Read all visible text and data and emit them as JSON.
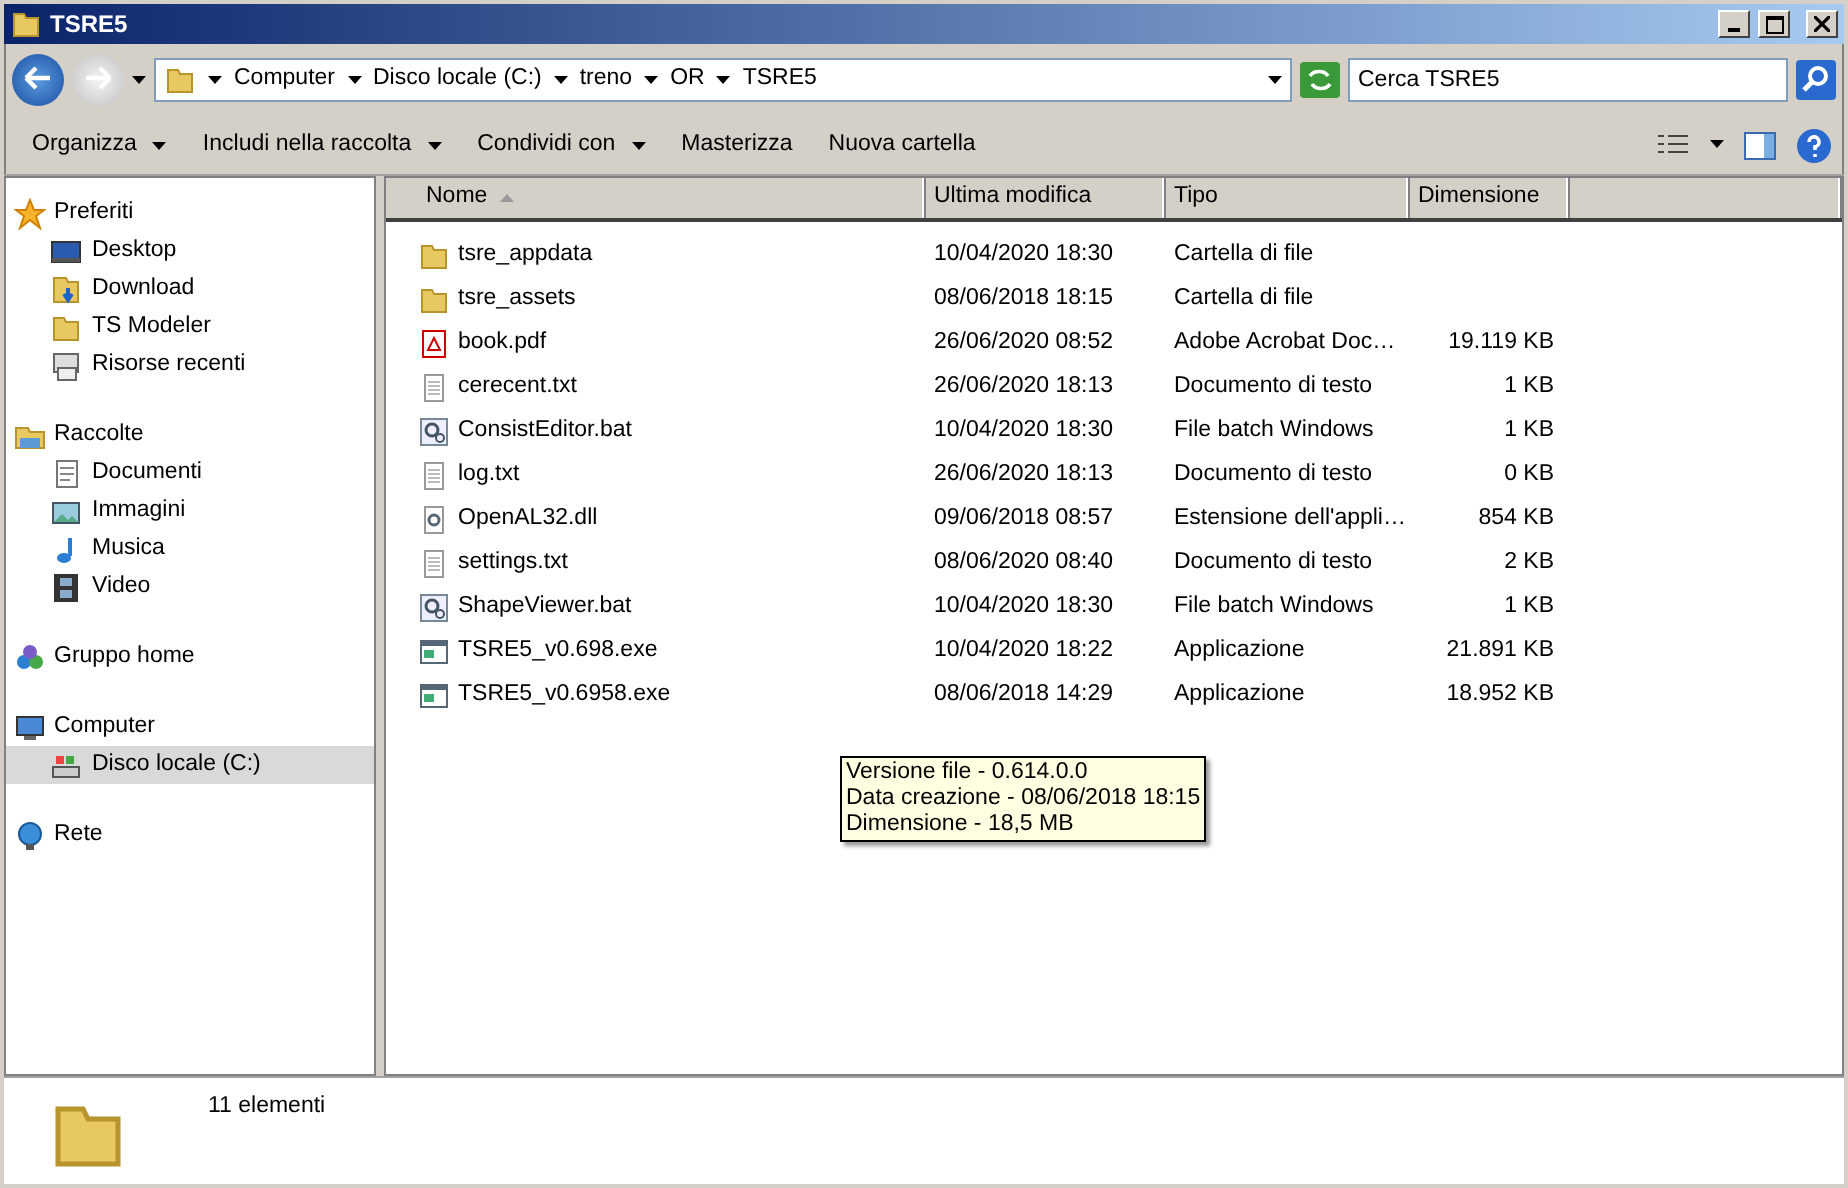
{
  "window": {
    "title": "TSRE5"
  },
  "address": {
    "breadcrumbs": [
      "Computer",
      "Disco locale (C:)",
      "treno",
      "OR",
      "TSRE5"
    ]
  },
  "search": {
    "placeholder": "Cerca TSRE5"
  },
  "toolbar": {
    "buttons": [
      {
        "label": "Organizza",
        "dropdown": true
      },
      {
        "label": "Includi nella raccolta",
        "dropdown": true
      },
      {
        "label": "Condividi con",
        "dropdown": true
      },
      {
        "label": "Masterizza",
        "dropdown": false
      },
      {
        "label": "Nuova cartella",
        "dropdown": false
      }
    ]
  },
  "sidebar": {
    "groups": [
      {
        "label": "Preferiti",
        "kind": "star",
        "selected": false,
        "items": [
          {
            "label": "Desktop",
            "kind": "desktop",
            "selected": false
          },
          {
            "label": "Download",
            "kind": "download",
            "selected": false
          },
          {
            "label": "TS Modeler",
            "kind": "folder",
            "selected": false
          },
          {
            "label": "Risorse recenti",
            "kind": "recent",
            "selected": false
          }
        ]
      },
      {
        "label": "Raccolte",
        "kind": "library",
        "selected": false,
        "items": [
          {
            "label": "Documenti",
            "kind": "document",
            "selected": false
          },
          {
            "label": "Immagini",
            "kind": "image",
            "selected": false
          },
          {
            "label": "Musica",
            "kind": "music",
            "selected": false
          },
          {
            "label": "Video",
            "kind": "video",
            "selected": false
          }
        ]
      },
      {
        "label": "Gruppo home",
        "kind": "homegroup",
        "selected": false
      },
      {
        "label": "Computer",
        "kind": "computer",
        "selected": false,
        "items": [
          {
            "label": "Disco locale (C:)",
            "kind": "drive",
            "selected": true
          }
        ]
      },
      {
        "label": "Rete",
        "kind": "network",
        "selected": false
      }
    ]
  },
  "table": {
    "columns": [
      {
        "label": "Nome",
        "sorted": true
      },
      {
        "label": "Ultima modifica",
        "sorted": false
      },
      {
        "label": "Tipo",
        "sorted": false
      },
      {
        "label": "Dimensione",
        "sorted": false
      }
    ],
    "rows": [
      {
        "kind": "folder",
        "name": "tsre_appdata",
        "modified": "10/04/2020 18:30",
        "type": "Cartella di file"
      },
      {
        "kind": "folder",
        "name": "tsre_assets",
        "modified": "08/06/2018 18:15",
        "type": "Cartella di file"
      },
      {
        "kind": "pdf",
        "name": "book.pdf",
        "modified": "26/06/2020 08:52",
        "type": "Adobe Acrobat Doc…",
        "size": "19.119 KB"
      },
      {
        "kind": "text",
        "name": "cerecent.txt",
        "modified": "26/06/2020 18:13",
        "type": "Documento di testo",
        "size": "1 KB"
      },
      {
        "kind": "batch",
        "name": "ConsistEditor.bat",
        "modified": "10/04/2020 18:30",
        "type": "File batch Windows",
        "size": "1 KB"
      },
      {
        "kind": "text",
        "name": "log.txt",
        "modified": "26/06/2020 18:13",
        "type": "Documento di testo",
        "size": "0 KB"
      },
      {
        "kind": "dll",
        "name": "OpenAL32.dll",
        "modified": "09/06/2018 08:57",
        "type": "Estensione dell'appli…",
        "size": "854 KB"
      },
      {
        "kind": "text",
        "name": "settings.txt",
        "modified": "08/06/2020 08:40",
        "type": "Documento di testo",
        "size": "2 KB"
      },
      {
        "kind": "batch",
        "name": "ShapeViewer.bat",
        "modified": "10/04/2020 18:30",
        "type": "File batch Windows",
        "size": "1 KB"
      },
      {
        "kind": "exe",
        "name": "TSRE5_v0.698.exe",
        "modified": "10/04/2020 18:22",
        "type": "Applicazione",
        "size": "21.891 KB"
      },
      {
        "kind": "exe",
        "name": "TSRE5_v0.6958.exe",
        "modified": "08/06/2018 14:29",
        "type": "Applicazione",
        "size": "18.952 KB"
      }
    ]
  },
  "tooltip": {
    "lines": [
      "Versione file - 0.614.0.0",
      "Data creazione - 08/06/2018 18:15",
      "Dimensione - 18,5 MB"
    ]
  },
  "details": {
    "text": "11 elementi"
  }
}
